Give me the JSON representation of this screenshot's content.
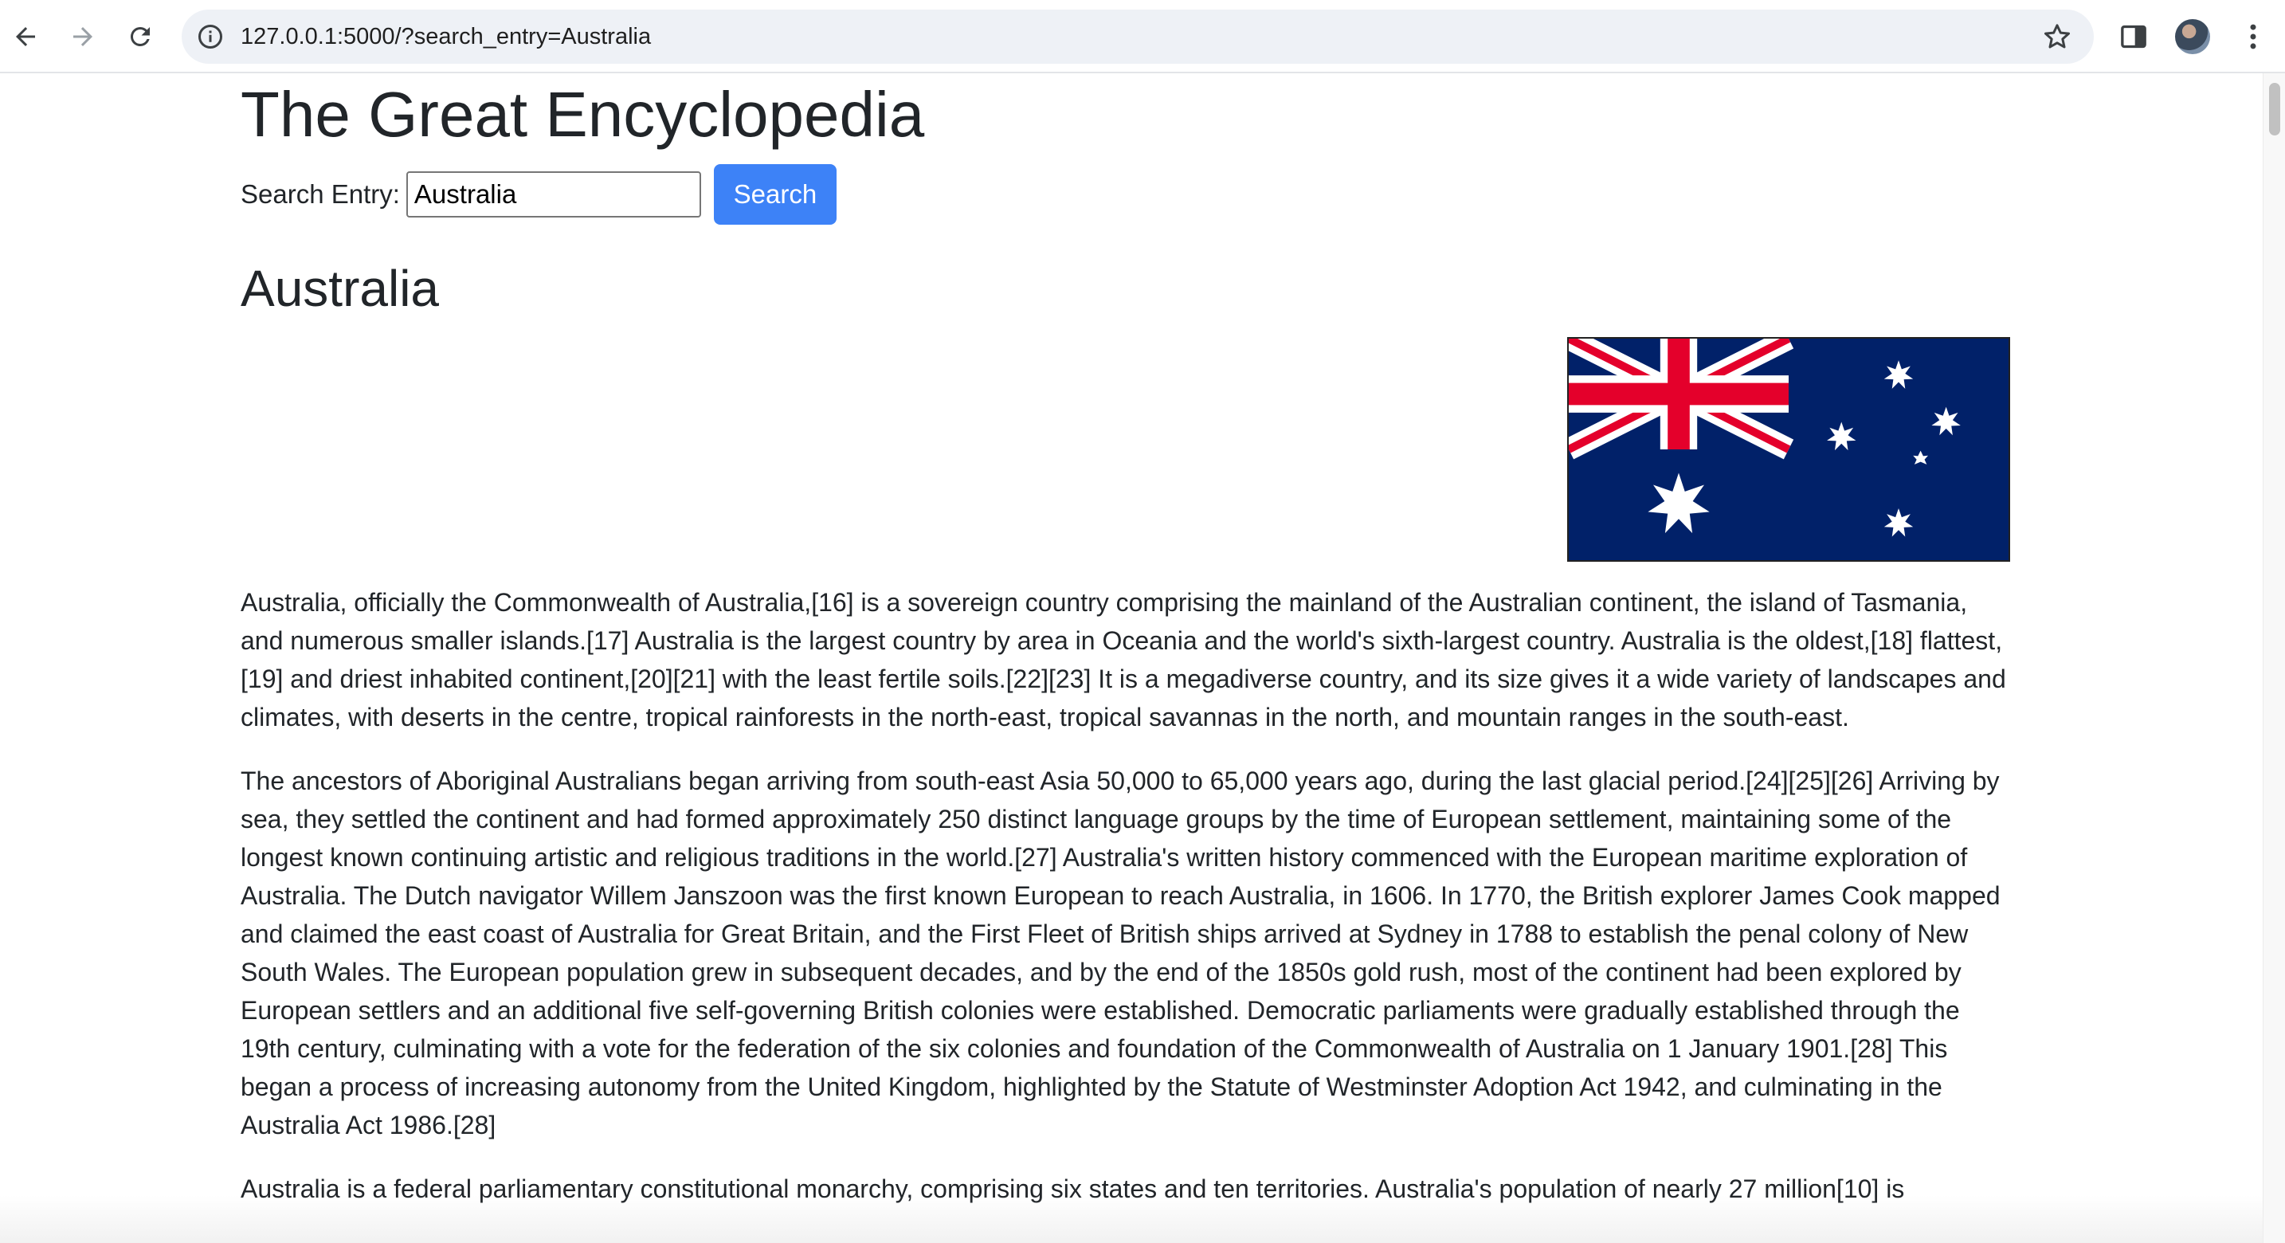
{
  "browser": {
    "url": "127.0.0.1:5000/?search_entry=Australia",
    "icons": {
      "back": "arrow-left-icon",
      "forward": "arrow-right-icon",
      "reload": "reload-icon",
      "info": "info-icon",
      "bookmark": "star-icon",
      "side_panel": "side-panel-icon",
      "profile": "avatar",
      "menu": "kebab-menu-icon"
    }
  },
  "page": {
    "site_title": "The Great Encyclopedia",
    "search": {
      "label": "Search Entry:",
      "value": "Australia",
      "button_label": "Search"
    },
    "entry": {
      "title": "Australia",
      "image": "australian-flag",
      "paragraphs": [
        "Australia, officially the Commonwealth of Australia,[16] is a sovereign country comprising the mainland of the Australian continent, the island of Tasmania, and numerous smaller islands.[17] Australia is the largest country by area in Oceania and the world's sixth-largest country. Australia is the oldest,[18] flattest,[19] and driest inhabited continent,[20][21] with the least fertile soils.[22][23] It is a megadiverse country, and its size gives it a wide variety of landscapes and climates, with deserts in the centre, tropical rainforests in the north-east, tropical savannas in the north, and mountain ranges in the south-east.",
        "The ancestors of Aboriginal Australians began arriving from south-east Asia 50,000 to 65,000 years ago, during the last glacial period.[24][25][26] Arriving by sea, they settled the continent and had formed approximately 250 distinct language groups by the time of European settlement, maintaining some of the longest known continuing artistic and religious traditions in the world.[27] Australia's written history commenced with the European maritime exploration of Australia. The Dutch navigator Willem Janszoon was the first known European to reach Australia, in 1606. In 1770, the British explorer James Cook mapped and claimed the east coast of Australia for Great Britain, and the First Fleet of British ships arrived at Sydney in 1788 to establish the penal colony of New South Wales. The European population grew in subsequent decades, and by the end of the 1850s gold rush, most of the continent had been explored by European settlers and an additional five self-governing British colonies were established. Democratic parliaments were gradually established through the 19th century, culminating with a vote for the federation of the six colonies and foundation of the Commonwealth of Australia on 1 January 1901.[28] This began a process of increasing autonomy from the United Kingdom, highlighted by the Statute of Westminster Adoption Act 1942, and culminating in the Australia Act 1986.[28]",
        "Australia is a federal parliamentary constitutional monarchy, comprising six states and ten territories. Australia's population of nearly 27 million[10] is"
      ]
    }
  },
  "colors": {
    "button_bg": "#3d82f7",
    "text": "#212529",
    "flag_blue": "#012169",
    "flag_red": "#e4002b"
  }
}
